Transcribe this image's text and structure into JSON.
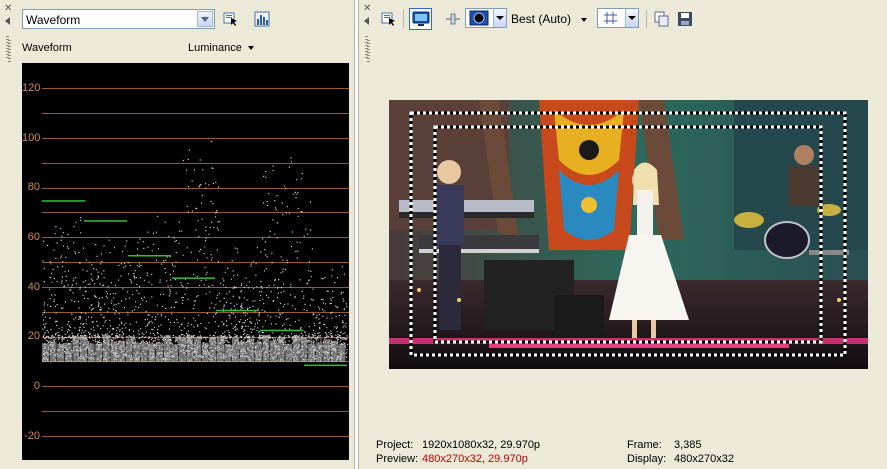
{
  "scope_panel": {
    "type_select": "Waveform",
    "title": "Waveform",
    "channel": "Luminance",
    "axis_labels": [
      "120",
      "100",
      "80",
      "60",
      "40",
      "20",
      "0",
      "-20"
    ]
  },
  "preview_panel": {
    "quality": "Best (Auto)",
    "status": {
      "project_label": "Project:",
      "project_value": "1920x1080x32, 29.970p",
      "preview_label": "Preview:",
      "preview_value": "480x270x32, 29.970p",
      "frame_label": "Frame:",
      "frame_value": "3,385",
      "display_label": "Display:",
      "display_value": "480x270x32"
    }
  },
  "colors": {
    "panel_bg": "#ece9d8",
    "scope_bg": "#000000",
    "grid": "#9b5a2a",
    "axis_text": "#d48c4a",
    "warning": "#c00000"
  }
}
